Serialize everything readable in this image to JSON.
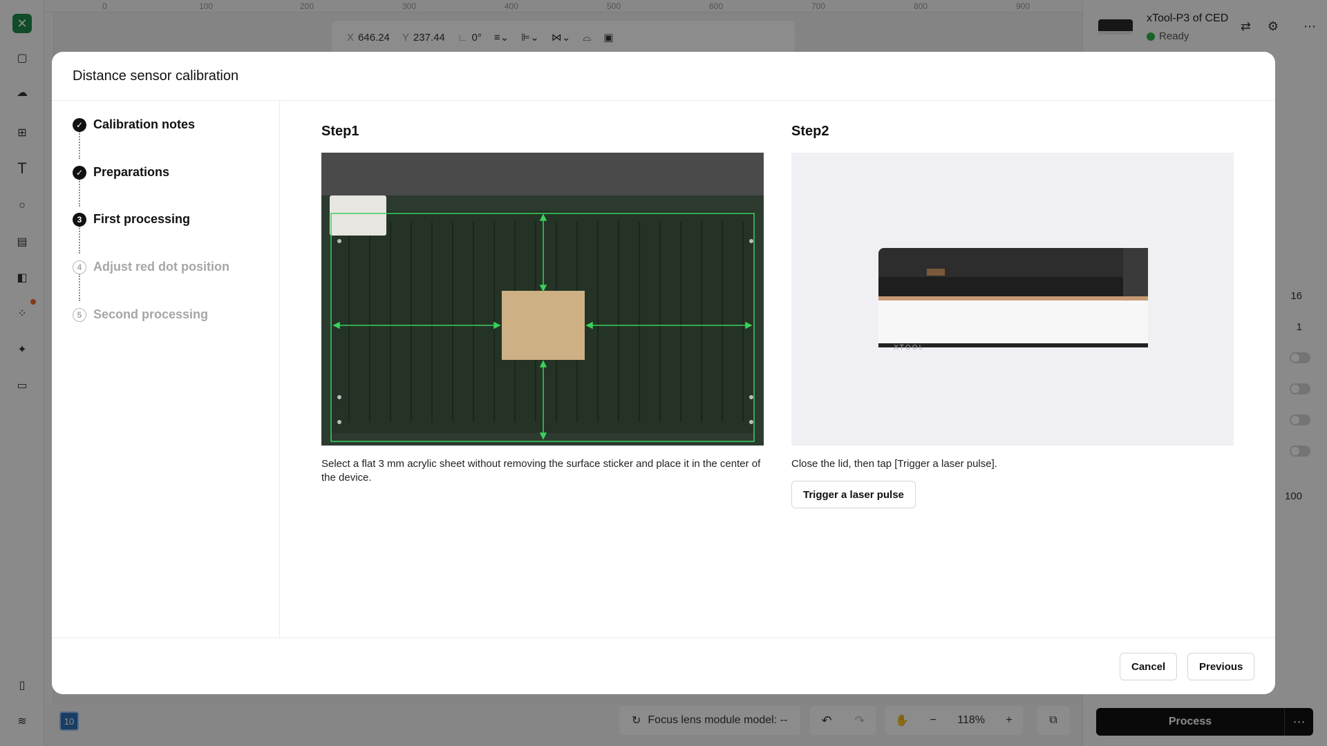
{
  "app": {
    "ruler_ticks": [
      "0",
      "100",
      "200",
      "300",
      "400",
      "500",
      "600",
      "700",
      "800",
      "900"
    ],
    "toolbar": {
      "x_label": "X",
      "x_value": "646.24",
      "y_label": "Y",
      "y_value": "237.44",
      "angle_value": "0°"
    },
    "device": {
      "name": "xTool-P3 of CED",
      "status": "Ready"
    },
    "right_values": [
      "16",
      "1",
      "100"
    ],
    "process_label": "Process",
    "focus_lens": "Focus lens module model: --",
    "zoom": "118%",
    "layer_badge": "10"
  },
  "dialog": {
    "title": "Distance sensor calibration",
    "steps": [
      {
        "num": "1",
        "label": "Calibration notes",
        "state": "done"
      },
      {
        "num": "2",
        "label": "Preparations",
        "state": "done"
      },
      {
        "num": "3",
        "label": "First processing",
        "state": "current"
      },
      {
        "num": "4",
        "label": "Adjust red dot position",
        "state": "pending"
      },
      {
        "num": "5",
        "label": "Second processing",
        "state": "pending"
      }
    ],
    "step1": {
      "heading": "Step1",
      "description": "Select a flat 3 mm acrylic sheet without removing the surface sticker and place it in the center of the device."
    },
    "step2": {
      "heading": "Step2",
      "description": "Close the lid, then tap [Trigger a laser pulse].",
      "button": "Trigger a laser pulse",
      "device_logo": "XTOOL"
    },
    "cancel_label": "Cancel",
    "previous_label": "Previous"
  },
  "colors": {
    "accent_green": "#2fb34a",
    "button_dark": "#111111",
    "guide_green": "#3ad15a"
  }
}
